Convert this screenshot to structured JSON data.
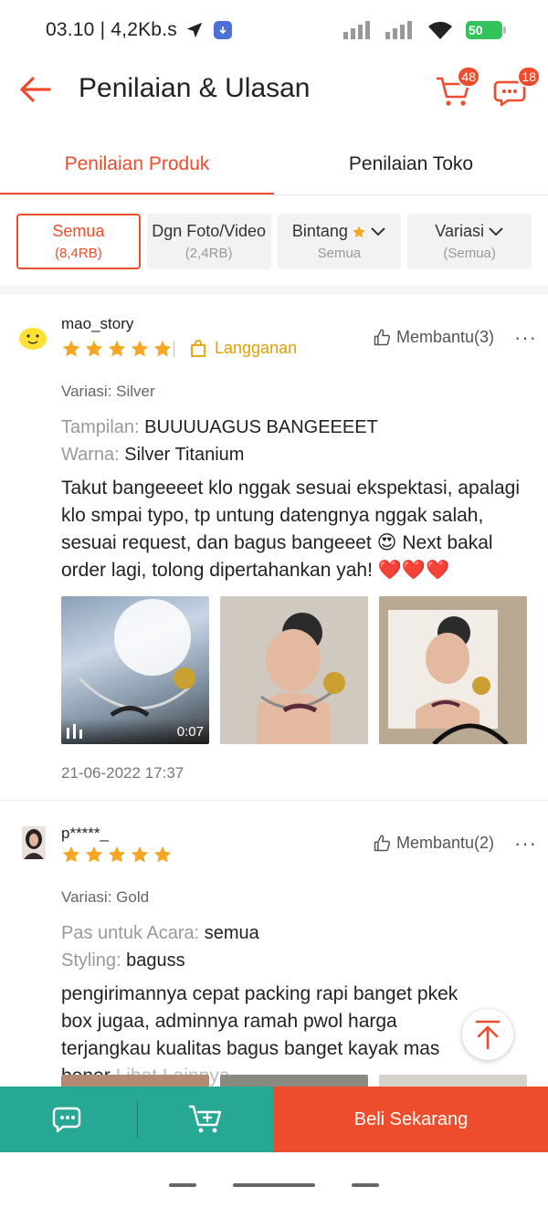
{
  "status_bar": {
    "time": "03.10 | 4,2Kb.s",
    "battery": "50"
  },
  "header": {
    "title": "Penilaian & Ulasan",
    "cart_badge": "48",
    "chat_badge": "18"
  },
  "tabs": [
    {
      "label": "Penilaian Produk",
      "active": true
    },
    {
      "label": "Penilaian Toko",
      "active": false
    }
  ],
  "filters": [
    {
      "label": "Semua",
      "sub": "(8,4RB)"
    },
    {
      "label": "Dgn Foto/Video",
      "sub": "(2,4RB)"
    },
    {
      "label": "Bintang",
      "sub": "Semua"
    },
    {
      "label": "Variasi",
      "sub": "(Semua)"
    }
  ],
  "reviews": [
    {
      "username": "mao_story",
      "rating": 5,
      "badge": "Langganan",
      "helpful": "Membantu(3)",
      "variant": "Variasi: Silver",
      "attributes": [
        {
          "key": "Tampilan:",
          "value": "BUUUUAGUS BANGEEEET"
        },
        {
          "key": "Warna:",
          "value": "Silver Titanium"
        }
      ],
      "text": "Takut bangeeeet klo nggak sesuai ekspektasi, apalagi klo smpai typo, tp untung datengnya nggak salah, sesuai request, dan bagus bangeeet 😍 Next bakal order lagi, tolong dipertahankan yah! ❤️❤️❤️",
      "video_duration": "0:07",
      "date": "21-06-2022 17:37"
    },
    {
      "username": "p*****_",
      "rating": 5,
      "helpful": "Membantu(2)",
      "variant": "Variasi: Gold",
      "attributes": [
        {
          "key": "Pas untuk Acara:",
          "value": "semua"
        },
        {
          "key": "Styling:",
          "value": "baguss"
        }
      ],
      "text": "pengirimannya cepat packing rapi banget pkek box jugaa, adminnya ramah pwol harga terjangkau kualitas bagus banget kayak mas bener",
      "more_label": "Lihat Lainnya"
    }
  ],
  "bottom_bar": {
    "buy_label": "Beli Sekarang"
  },
  "colors": {
    "accent": "#ee4d2d",
    "teal": "#27a894",
    "star": "#f5a623",
    "subscription": "#e4a100"
  }
}
